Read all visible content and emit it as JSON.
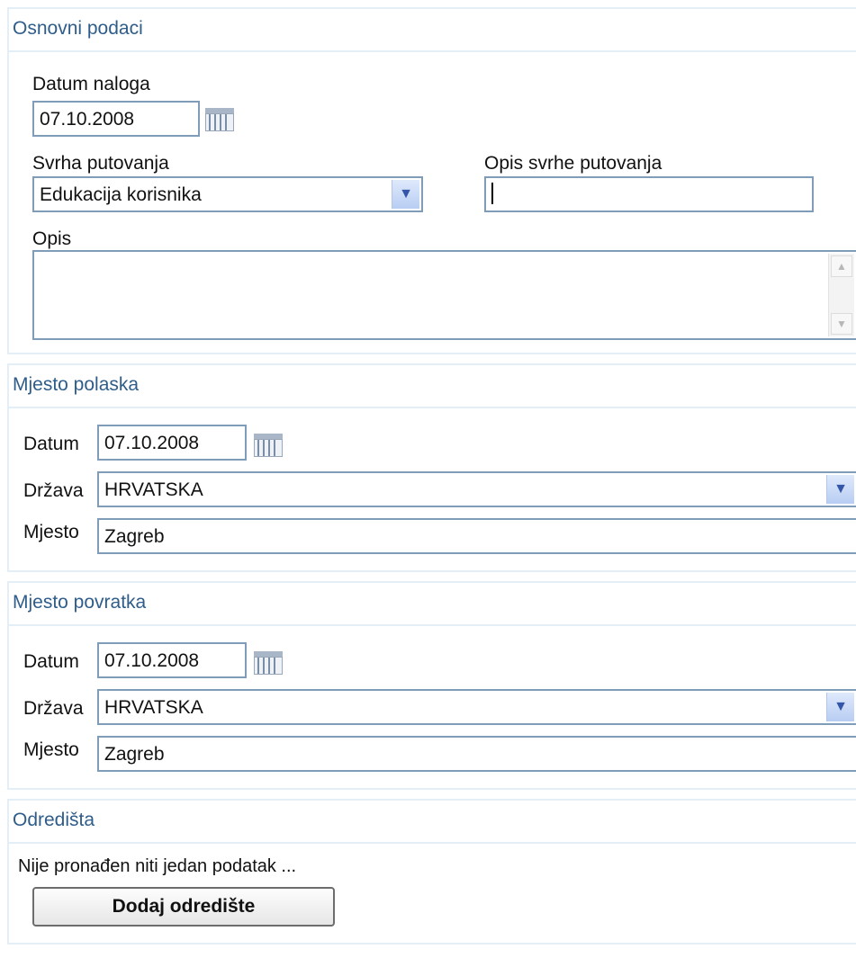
{
  "osnovni": {
    "title": "Osnovni podaci",
    "datum_naloga_label": "Datum naloga",
    "datum_naloga_value": "07.10.2008",
    "svrha_label": "Svrha putovanja",
    "svrha_value": "Edukacija korisnika",
    "opis_svrhe_label": "Opis svrhe putovanja",
    "opis_svrhe_value": "",
    "opis_label": "Opis"
  },
  "polazak": {
    "title": "Mjesto polaska",
    "datum_label": "Datum",
    "datum_value": "07.10.2008",
    "drzava_label": "Država",
    "drzava_value": "HRVATSKA",
    "mjesto_label": "Mjesto",
    "mjesto_value": "Zagreb"
  },
  "povratak": {
    "title": "Mjesto povratka",
    "datum_label": "Datum",
    "datum_value": "07.10.2008",
    "drzava_label": "Država",
    "drzava_value": "HRVATSKA",
    "mjesto_label": "Mjesto",
    "mjesto_value": "Zagreb"
  },
  "odredista": {
    "title": "Odredišta",
    "empty_message": "Nije pronađen niti jedan podatak ...",
    "add_button_label": "Dodaj odredište"
  },
  "icons": {
    "calendar": "calendar-icon",
    "dropdown": "chevron-down-icon",
    "scroll_up": "scroll-up-arrow-icon",
    "scroll_down": "scroll-down-arrow-icon"
  },
  "colors": {
    "section_border": "#e3eef7",
    "section_title": "#2f5d8a",
    "input_border": "#7f9db9"
  }
}
